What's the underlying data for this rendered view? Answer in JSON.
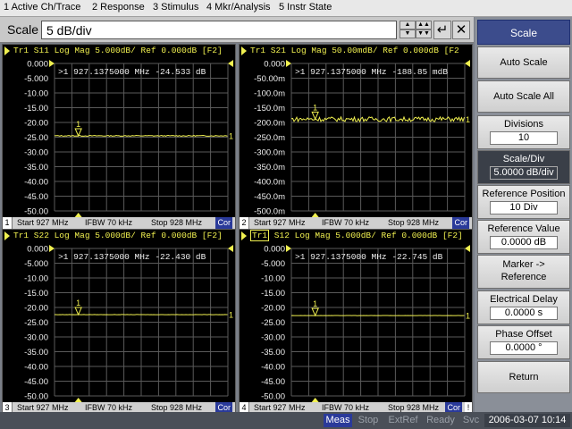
{
  "menu": [
    "1 Active Ch/Trace",
    "2 Response",
    "3 Stimulus",
    "4 Mkr/Analysis",
    "5 Instr State"
  ],
  "entry": {
    "label": "Scale",
    "value": "5 dB/div",
    "enter_glyph": "↵",
    "close_glyph": "✕"
  },
  "panels": [
    {
      "header": "Tr1 S11 Log Mag 5.000dB/ Ref 0.000dB [F2]",
      "tr1_boxed": false,
      "marker_readout": ">1  927.1375000 MHz -24.533 dB",
      "y_labels": [
        "0.000",
        "-5.000",
        "-10.00",
        "-15.00",
        "-20.00",
        "-25.00",
        "-30.00",
        "-35.00",
        "-40.00",
        "-45.00",
        "-50.00"
      ],
      "ref_value": 0,
      "per_div": 5,
      "trace_level": -24.533,
      "noise": 0.15,
      "marker_label": "1",
      "footer": {
        "ch": "1",
        "start": "Start 927 MHz",
        "ifbw": "IFBW 70 kHz",
        "stop": "Stop 928 MHz",
        "cor": "Cor"
      }
    },
    {
      "header": "Tr1 S21 Log Mag 50.00mdB/ Ref 0.000dB [F2",
      "tr1_boxed": false,
      "marker_readout": ">1  927.1375000 MHz -188.85 mdB",
      "y_labels": [
        "0.000",
        "-50.00m",
        "-100.0m",
        "-150.0m",
        "-200.0m",
        "-250.0m",
        "-300.0m",
        "-350.0m",
        "-400.0m",
        "-450.0m",
        "-500.0m"
      ],
      "ref_value": 0,
      "per_div": 50,
      "trace_level": -188.85,
      "noise": 8,
      "marker_label": "1",
      "footer": {
        "ch": "2",
        "start": "Start 927 MHz",
        "ifbw": "IFBW 70 kHz",
        "stop": "Stop 928 MHz",
        "cor": "Cor"
      }
    },
    {
      "header": "Tr1 S22 Log Mag 5.000dB/ Ref 0.000dB [F2]",
      "tr1_boxed": false,
      "marker_readout": ">1  927.1375000 MHz -22.430 dB",
      "y_labels": [
        "0.000",
        "-5.000",
        "-10.00",
        "-15.00",
        "-20.00",
        "-25.00",
        "-30.00",
        "-35.00",
        "-40.00",
        "-45.00",
        "-50.00"
      ],
      "ref_value": 0,
      "per_div": 5,
      "trace_level": -22.43,
      "noise": 0.03,
      "marker_label": "1",
      "footer": {
        "ch": "3",
        "start": "Start 927 MHz",
        "ifbw": "IFBW 70 kHz",
        "stop": "Stop 928 MHz",
        "cor": "Cor"
      }
    },
    {
      "header_prefix": "Tr1",
      "header": " S12 Log Mag 5.000dB/ Ref 0.000dB [F2]",
      "tr1_boxed": true,
      "marker_readout": ">1  927.1375000 MHz -22.745 dB",
      "y_labels": [
        "0.000",
        "-5.000",
        "-10.00",
        "-15.00",
        "-20.00",
        "-25.00",
        "-30.00",
        "-35.00",
        "-40.00",
        "-45.00",
        "-50.00"
      ],
      "ref_value": 0,
      "per_div": 5,
      "trace_level": -22.745,
      "noise": 0.03,
      "marker_label": "1",
      "footer": {
        "ch": "4",
        "start": "Start 927 MHz",
        "ifbw": "IFBW 70 kHz",
        "stop": "Stop 928 MHz",
        "cor": "Cor",
        "excl": "!"
      }
    }
  ],
  "softkeys": {
    "title": "Scale",
    "items": [
      {
        "label": "Auto Scale"
      },
      {
        "label": "Auto Scale All"
      },
      {
        "label": "Divisions",
        "value": "10"
      },
      {
        "label": "Scale/Div",
        "value": "5.0000 dB/div",
        "active": true
      },
      {
        "label": "Reference Position",
        "value": "10 Div"
      },
      {
        "label": "Reference Value",
        "value": "0.0000 dB"
      },
      {
        "label": "Marker -> Reference"
      },
      {
        "label": "Electrical Delay",
        "value": "0.0000 s"
      },
      {
        "label": "Phase Offset",
        "value": "0.0000 °"
      },
      {
        "label": "Return"
      }
    ]
  },
  "status": {
    "meas": "Meas",
    "stop": "Stop",
    "extref": "ExtRef",
    "ready": "Ready",
    "svc": "Svc",
    "datetime": "2006-03-07 10:14"
  },
  "colors": {
    "trace": "#f0f050",
    "grid": "#5a5a5a",
    "label": "#f0f0f0",
    "cor_bg": "#2a3a9a",
    "softkey_title": "#3c4c8c"
  }
}
